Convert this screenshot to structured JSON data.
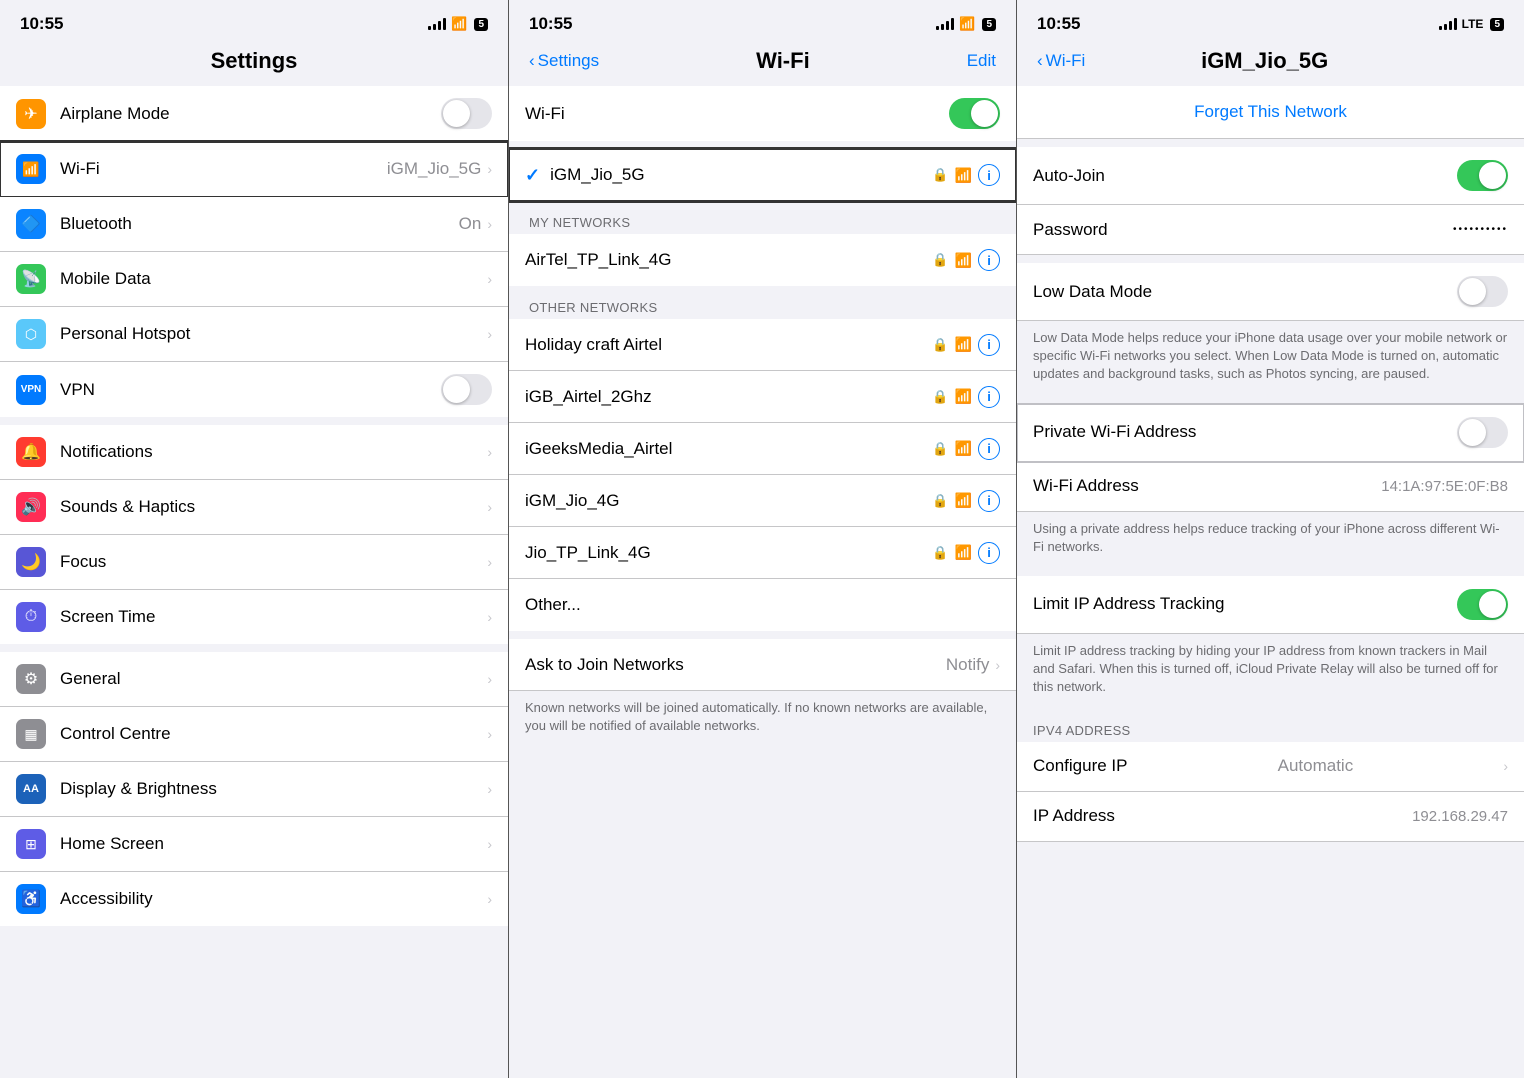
{
  "panel1": {
    "statusBar": {
      "time": "10:55",
      "batteryLabel": "5"
    },
    "title": "Settings",
    "items": [
      {
        "id": "airplane-mode",
        "icon": "✈",
        "iconClass": "icon-orange",
        "label": "Airplane Mode",
        "hasToggle": true,
        "toggleOn": false
      },
      {
        "id": "wifi",
        "icon": "📶",
        "iconClass": "icon-blue",
        "label": "Wi-Fi",
        "value": "iGM_Jio_5G",
        "hasChevron": true,
        "highlighted": true
      },
      {
        "id": "bluetooth",
        "icon": "🔷",
        "iconClass": "icon-blue-dark",
        "label": "Bluetooth",
        "value": "On",
        "hasChevron": true
      },
      {
        "id": "mobile-data",
        "icon": "📡",
        "iconClass": "icon-green",
        "label": "Mobile Data",
        "hasChevron": true
      },
      {
        "id": "personal-hotspot",
        "icon": "⬡",
        "iconClass": "icon-teal",
        "label": "Personal Hotspot",
        "hasChevron": true
      },
      {
        "id": "vpn",
        "icon": "VPN",
        "iconClass": "icon-blue",
        "label": "VPN",
        "hasToggle": true,
        "toggleOn": false
      }
    ],
    "items2": [
      {
        "id": "notifications",
        "icon": "🔔",
        "iconClass": "icon-red",
        "label": "Notifications",
        "hasChevron": true
      },
      {
        "id": "sounds",
        "icon": "🔊",
        "iconClass": "icon-pink",
        "label": "Sounds & Haptics",
        "hasChevron": true
      },
      {
        "id": "focus",
        "icon": "🌙",
        "iconClass": "icon-purple",
        "label": "Focus",
        "hasChevron": true
      },
      {
        "id": "screen-time",
        "icon": "⏱",
        "iconClass": "icon-indigo",
        "label": "Screen Time",
        "hasChevron": true
      }
    ],
    "items3": [
      {
        "id": "general",
        "icon": "⚙",
        "iconClass": "icon-gray",
        "label": "General",
        "hasChevron": true
      },
      {
        "id": "control-centre",
        "icon": "▦",
        "iconClass": "icon-gray",
        "label": "Control Centre",
        "hasChevron": true
      },
      {
        "id": "display",
        "icon": "AA",
        "iconClass": "icon-blue-aa",
        "label": "Display & Brightness",
        "hasChevron": true
      },
      {
        "id": "home-screen",
        "icon": "⊞",
        "iconClass": "icon-indigo",
        "label": "Home Screen",
        "hasChevron": true
      },
      {
        "id": "accessibility",
        "icon": "♿",
        "iconClass": "icon-blue",
        "label": "Accessibility",
        "hasChevron": true
      }
    ]
  },
  "panel2": {
    "statusBar": {
      "time": "10:55",
      "batteryLabel": "5"
    },
    "backLabel": "Settings",
    "title": "Wi-Fi",
    "editLabel": "Edit",
    "wifiToggleOn": true,
    "connectedNetwork": {
      "name": "iGM_Jio_5G",
      "hasLock": true
    },
    "myNetworks": {
      "header": "MY NETWORKS",
      "items": [
        {
          "id": "airtel-tp",
          "name": "AirTel_TP_Link_4G",
          "hasLock": true
        }
      ]
    },
    "otherNetworks": {
      "header": "OTHER NETWORKS",
      "items": [
        {
          "id": "holiday",
          "name": "Holiday craft Airtel",
          "hasLock": true
        },
        {
          "id": "igb",
          "name": "iGB_Airtel_2Ghz",
          "hasLock": true
        },
        {
          "id": "igeeks",
          "name": "iGeeksMedia_Airtel",
          "hasLock": true
        },
        {
          "id": "igm-jio-4g",
          "name": "iGM_Jio_4G",
          "hasLock": true
        },
        {
          "id": "jio-tp",
          "name": "Jio_TP_Link_4G",
          "hasLock": true
        }
      ]
    },
    "otherOption": "Other...",
    "askToJoin": {
      "label": "Ask to Join Networks",
      "value": "Notify",
      "description": "Known networks will be joined automatically. If no known networks are available, you will be notified of available networks."
    }
  },
  "panel3": {
    "statusBar": {
      "time": "10:55",
      "batteryLabel": "5",
      "lte": true
    },
    "backLabel": "Wi-Fi",
    "title": "iGM_Jio_5G",
    "forgetNetwork": "Forget This Network",
    "autoJoin": {
      "label": "Auto-Join",
      "on": true
    },
    "password": {
      "label": "Password",
      "dots": "••••••••••"
    },
    "lowDataMode": {
      "label": "Low Data Mode",
      "on": false,
      "description": "Low Data Mode helps reduce your iPhone data usage over your mobile network or specific Wi-Fi networks you select. When Low Data Mode is turned on, automatic updates and background tasks, such as Photos syncing, are paused."
    },
    "privateWifi": {
      "label": "Private Wi-Fi Address",
      "on": false,
      "highlighted": true
    },
    "wifiAddress": {
      "label": "Wi-Fi Address",
      "value": "14:1A:97:5E:0F:B8"
    },
    "wifiAddressDesc": "Using a private address helps reduce tracking of your iPhone across different Wi-Fi networks.",
    "limitIPTracking": {
      "label": "Limit IP Address Tracking",
      "on": true,
      "description": "Limit IP address tracking by hiding your IP address from known trackers in Mail and Safari. When this is turned off, iCloud Private Relay will also be turned off for this network."
    },
    "ipv4Header": "IPV4 ADDRESS",
    "configureIP": {
      "label": "Configure IP",
      "value": "Automatic"
    },
    "ipAddress": {
      "label": "IP Address",
      "value": "192.168.29.47"
    }
  }
}
